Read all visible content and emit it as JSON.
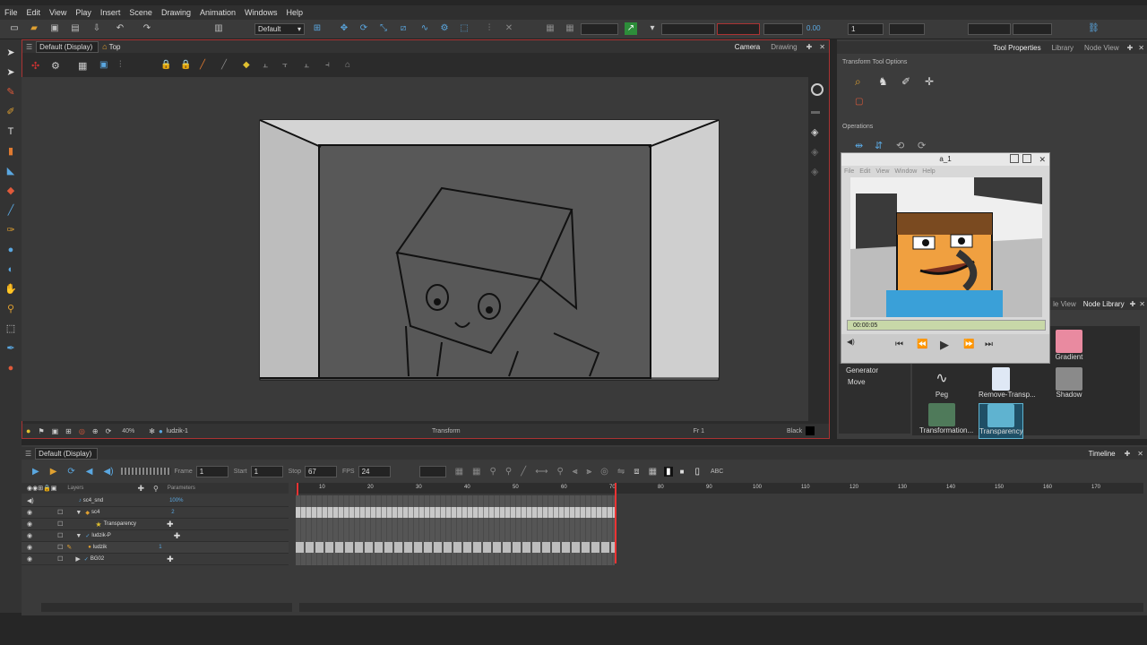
{
  "menu": [
    "File",
    "Edit",
    "View",
    "Play",
    "Insert",
    "Scene",
    "Drawing",
    "Animation",
    "Windows",
    "Help"
  ],
  "toolbar": {
    "workspace": "Default",
    "zoom_value": "0.00",
    "field1": "1"
  },
  "view": {
    "mode": "Default (Display)",
    "breadcrumb": "Top",
    "tabs": [
      "Camera",
      "Drawing"
    ],
    "zoom": "40%",
    "layer_name": "ludzik-1",
    "tool_label": "Transform",
    "frame_label": "Fr 1",
    "bg_color": "Black"
  },
  "right_tabs": [
    "Tool Properties",
    "Library",
    "Node View"
  ],
  "tool_options": {
    "title": "Transform Tool Options",
    "operations": "Operations"
  },
  "player": {
    "title": "a_1",
    "menu": [
      "File",
      "Edit",
      "View",
      "Window",
      "Help"
    ],
    "time": "00:00:05"
  },
  "node_library": {
    "tabs": [
      "le View",
      "Node Library"
    ],
    "categories": [
      "Generator",
      "Move"
    ],
    "nodes": [
      {
        "name": "Gradient",
        "color": "#e98aa0"
      },
      {
        "name": "Peg",
        "color": "#3a3a3a"
      },
      {
        "name": "Remove-Transp...",
        "color": "#dfe8f5"
      },
      {
        "name": "Shadow",
        "color": "#8a8a8a"
      },
      {
        "name": "Transformation...",
        "color": "#5a7fa0"
      },
      {
        "name": "Transparency",
        "color": "#5fb3d0"
      }
    ]
  },
  "timeline": {
    "mode": "Default (Display)",
    "tab": "Timeline",
    "frame_label": "Frame",
    "frame": "1",
    "start_label": "Start",
    "start": "1",
    "stop_label": "Stop",
    "stop": "67",
    "fps_label": "FPS",
    "fps": "24",
    "col_layers": "Layers",
    "col_params": "Parameters",
    "layers": [
      {
        "name": "sc4_snd",
        "param": "100%"
      },
      {
        "name": "sc4",
        "param": "2"
      },
      {
        "name": "Transparency",
        "param": ""
      },
      {
        "name": "ludzik-P",
        "param": ""
      },
      {
        "name": "ludzik",
        "param": "1"
      },
      {
        "name": "BG02",
        "param": ""
      }
    ],
    "ruler": [
      "10",
      "20",
      "30",
      "40",
      "50",
      "60",
      "70",
      "80",
      "90",
      "100",
      "110",
      "120",
      "130",
      "140",
      "150",
      "160",
      "170"
    ]
  }
}
